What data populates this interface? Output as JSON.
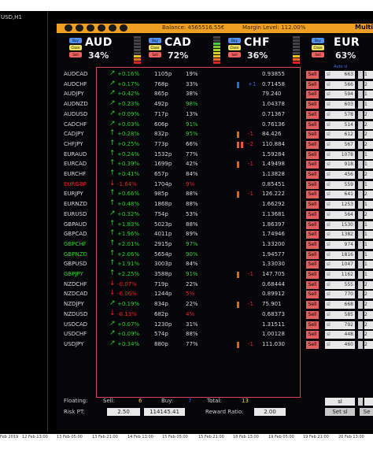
{
  "window": {
    "label": "USD,H1"
  },
  "topbar": {
    "balance": "Balance: 4565516.55€",
    "margin_level": "Margin Level: 112.00%",
    "multi": "Multi"
  },
  "currencies": [
    {
      "name": "AUD",
      "pct": "34%",
      "buy": "Buy",
      "close": "Close",
      "sell": "Sell"
    },
    {
      "name": "CAD",
      "pct": "72%",
      "buy": "Buy",
      "close": "Close",
      "sell": "Sell"
    },
    {
      "name": "CHF",
      "pct": "36%",
      "buy": "Buy",
      "close": "Close",
      "sell": "Sell"
    },
    {
      "name": "EUR",
      "pct": "63%",
      "buy": "Buy",
      "close": "Close",
      "sell": "Sell"
    }
  ],
  "auto_sl": "Auto sl",
  "rows": [
    {
      "pair": "AUDCAD",
      "pc": "white",
      "arrow": "↗",
      "ac": "green",
      "chg": "+0.16%",
      "cc": "green",
      "pips": "1105p",
      "perc": "19%",
      "pcc": "white",
      "mark": "",
      "mark2": "",
      "mlabel": "",
      "mlc": "white",
      "price": "0.93855",
      "sell": "Sell",
      "sl": "663",
      "last": "1"
    },
    {
      "pair": "AUDCHF",
      "pc": "white",
      "arrow": "↗",
      "ac": "green",
      "chg": "+0.17%",
      "cc": "green",
      "pips": "768p",
      "perc": "33%",
      "pcc": "white",
      "mark": "blue",
      "mark2": "",
      "mlabel": "+1",
      "mlc": "blue",
      "price": "0.71458",
      "sell": "Sell",
      "sl": "566",
      "last": "2"
    },
    {
      "pair": "AUDJPY",
      "pc": "white",
      "arrow": "↗",
      "ac": "green",
      "chg": "+0.42%",
      "cc": "green",
      "pips": "865p",
      "perc": "38%",
      "pcc": "white",
      "mark": "",
      "mark2": "",
      "mlabel": "",
      "mlc": "white",
      "price": "79.240",
      "sell": "Sell",
      "sl": "594",
      "last": "1"
    },
    {
      "pair": "AUDNZD",
      "pc": "white",
      "arrow": "↗",
      "ac": "green",
      "chg": "+0.23%",
      "cc": "green",
      "pips": "492p",
      "perc": "98%",
      "pcc": "green",
      "mark": "",
      "mark2": "",
      "mlabel": "",
      "mlc": "white",
      "price": "1.04378",
      "sell": "Sell",
      "sl": "603",
      "last": "1"
    },
    {
      "pair": "AUDUSD",
      "pc": "white",
      "arrow": "↗",
      "ac": "green",
      "chg": "+0.09%",
      "cc": "green",
      "pips": "717p",
      "perc": "13%",
      "pcc": "white",
      "mark": "",
      "mark2": "",
      "mlabel": "",
      "mlc": "white",
      "price": "0.71367",
      "sell": "Sell",
      "sl": "578",
      "last": "2"
    },
    {
      "pair": "CADCHF",
      "pc": "white",
      "arrow": "↗",
      "ac": "green",
      "chg": "+0.03%",
      "cc": "green",
      "pips": "606p",
      "perc": "91%",
      "pcc": "green",
      "mark": "",
      "mark2": "",
      "mlabel": "",
      "mlc": "white",
      "price": "0.76136",
      "sell": "Sell",
      "sl": "514",
      "last": "2"
    },
    {
      "pair": "CADJPY",
      "pc": "white",
      "arrow": "↑",
      "ac": "green",
      "chg": "+0.28%",
      "cc": "green",
      "pips": "832p",
      "perc": "95%",
      "pcc": "green",
      "mark": "orange",
      "mark2": "",
      "mlabel": "-1",
      "mlc": "red",
      "price": "84.426",
      "sell": "Sell",
      "sl": "612",
      "last": "2"
    },
    {
      "pair": "CHFJPY",
      "pc": "white",
      "arrow": "↑",
      "ac": "green",
      "chg": "+0.25%",
      "cc": "green",
      "pips": "773p",
      "perc": "66%",
      "pcc": "white",
      "mark": "orange",
      "mark2": "orange",
      "mlabel": "-2",
      "mlc": "red",
      "price": "110.884",
      "sell": "Sell",
      "sl": "567",
      "last": "2"
    },
    {
      "pair": "EURAUD",
      "pc": "white",
      "arrow": "↑",
      "ac": "green",
      "chg": "+0.24%",
      "cc": "green",
      "pips": "1532p",
      "perc": "77%",
      "pcc": "white",
      "mark": "",
      "mark2": "",
      "mlabel": "",
      "mlc": "white",
      "price": "1.59284",
      "sell": "Sell",
      "sl": "1078",
      "last": "1"
    },
    {
      "pair": "EURCAD",
      "pc": "white",
      "arrow": "↑",
      "ac": "green",
      "chg": "+0.39%",
      "cc": "green",
      "pips": "1699p",
      "perc": "42%",
      "pcc": "white",
      "mark": "orange",
      "mark2": "",
      "mlabel": "-1",
      "mlc": "red",
      "price": "1.49498",
      "sell": "Sell",
      "sl": "918",
      "last": "1"
    },
    {
      "pair": "EURCHF",
      "pc": "white",
      "arrow": "↑",
      "ac": "green",
      "chg": "+0.41%",
      "cc": "green",
      "pips": "657p",
      "perc": "84%",
      "pcc": "white",
      "mark": "",
      "mark2": "",
      "mlabel": "",
      "mlc": "white",
      "price": "1.13828",
      "sell": "Sell",
      "sl": "456",
      "last": "2"
    },
    {
      "pair": "EURGBP",
      "pc": "red",
      "arrow": "↓",
      "ac": "red",
      "chg": "-1.64%",
      "cc": "red",
      "pips": "1704p",
      "perc": "9%",
      "pcc": "red",
      "mark": "",
      "mark2": "",
      "mlabel": "",
      "mlc": "white",
      "price": "0.85451",
      "sell": "Sell",
      "sl": "559",
      "last": "1"
    },
    {
      "pair": "EURJPY",
      "pc": "white",
      "arrow": "↑",
      "ac": "green",
      "chg": "+0.66%",
      "cc": "green",
      "pips": "985p",
      "perc": "88%",
      "pcc": "white",
      "mark": "orange",
      "mark2": "",
      "mlabel": "-1",
      "mlc": "red",
      "price": "126.222",
      "sell": "Sell",
      "sl": "641",
      "last": "2"
    },
    {
      "pair": "EURNZD",
      "pc": "white",
      "arrow": "↑",
      "ac": "green",
      "chg": "+0.48%",
      "cc": "green",
      "pips": "1868p",
      "perc": "88%",
      "pcc": "white",
      "mark": "",
      "mark2": "",
      "mlabel": "",
      "mlc": "white",
      "price": "1.66292",
      "sell": "Sell",
      "sl": "1253",
      "last": "1"
    },
    {
      "pair": "EURUSD",
      "pc": "white",
      "arrow": "↗",
      "ac": "green",
      "chg": "+0.32%",
      "cc": "green",
      "pips": "754p",
      "perc": "53%",
      "pcc": "white",
      "mark": "",
      "mark2": "",
      "mlabel": "",
      "mlc": "white",
      "price": "1.13681",
      "sell": "Sell",
      "sl": "564",
      "last": "2"
    },
    {
      "pair": "GBPAUD",
      "pc": "white",
      "arrow": "↑",
      "ac": "green",
      "chg": "+1.83%",
      "cc": "green",
      "pips": "5023p",
      "perc": "88%",
      "pcc": "white",
      "mark": "",
      "mark2": "",
      "mlabel": "",
      "mlc": "white",
      "price": "1.86397",
      "sell": "Sell",
      "sl": "1530",
      "last": "1"
    },
    {
      "pair": "GBPCAD",
      "pc": "white",
      "arrow": "↑",
      "ac": "green",
      "chg": "+1.96%",
      "cc": "green",
      "pips": "4011p",
      "perc": "89%",
      "pcc": "white",
      "mark": "",
      "mark2": "",
      "mlabel": "",
      "mlc": "white",
      "price": "1.74946",
      "sell": "Sell",
      "sl": "1382",
      "last": "1"
    },
    {
      "pair": "GBPCHF",
      "pc": "green",
      "arrow": "↑",
      "ac": "green",
      "chg": "+2.01%",
      "cc": "green",
      "pips": "2915p",
      "perc": "97%",
      "pcc": "green",
      "mark": "",
      "mark2": "",
      "mlabel": "",
      "mlc": "white",
      "price": "1.33200",
      "sell": "Sell",
      "sl": "974",
      "last": "1"
    },
    {
      "pair": "GBPNZD",
      "pc": "green",
      "arrow": "↑",
      "ac": "green",
      "chg": "+2.06%",
      "cc": "green",
      "pips": "5654p",
      "perc": "90%",
      "pcc": "green",
      "mark": "",
      "mark2": "",
      "mlabel": "",
      "mlc": "white",
      "price": "1.94577",
      "sell": "Sell",
      "sl": "1816",
      "last": "1"
    },
    {
      "pair": "GBPUSD",
      "pc": "white",
      "arrow": "↑",
      "ac": "green",
      "chg": "+1.91%",
      "cc": "green",
      "pips": "3003p",
      "perc": "84%",
      "pcc": "white",
      "mark": "",
      "mark2": "",
      "mlabel": "",
      "mlc": "white",
      "price": "1.33030",
      "sell": "Sell",
      "sl": "1047",
      "last": "1"
    },
    {
      "pair": "GBPJPY",
      "pc": "green",
      "arrow": "↑",
      "ac": "green",
      "chg": "+2.25%",
      "cc": "green",
      "pips": "3588p",
      "perc": "91%",
      "pcc": "green",
      "mark": "orange",
      "mark2": "",
      "mlabel": "-1",
      "mlc": "red",
      "price": "147.705",
      "sell": "Sell",
      "sl": "1162",
      "last": "1"
    },
    {
      "pair": "NZDCHF",
      "pc": "white",
      "arrow": "↓",
      "ac": "red",
      "chg": "-0.07%",
      "cc": "red",
      "pips": "719p",
      "perc": "22%",
      "pcc": "white",
      "mark": "",
      "mark2": "",
      "mlabel": "",
      "mlc": "white",
      "price": "0.68444",
      "sell": "Sell",
      "sl": "555",
      "last": "2"
    },
    {
      "pair": "NZDCAD",
      "pc": "white",
      "arrow": "↓",
      "ac": "red",
      "chg": "-0.06%",
      "cc": "red",
      "pips": "1244p",
      "perc": "5%",
      "pcc": "red",
      "mark": "",
      "mark2": "",
      "mlabel": "",
      "mlc": "white",
      "price": "0.89912",
      "sell": "Sell",
      "sl": "770",
      "last": "2"
    },
    {
      "pair": "NZDJPY",
      "pc": "white",
      "arrow": "↗",
      "ac": "green",
      "chg": "+0.19%",
      "cc": "green",
      "pips": "834p",
      "perc": "22%",
      "pcc": "white",
      "mark": "orange",
      "mark2": "",
      "mlabel": "-1",
      "mlc": "red",
      "price": "75.901",
      "sell": "Sell",
      "sl": "668",
      "last": "2"
    },
    {
      "pair": "NZDUSD",
      "pc": "white",
      "arrow": "↓",
      "ac": "red",
      "chg": "-0.13%",
      "cc": "red",
      "pips": "682p",
      "perc": "4%",
      "pcc": "red",
      "mark": "",
      "mark2": "",
      "mlabel": "",
      "mlc": "white",
      "price": "0.68373",
      "sell": "Sell",
      "sl": "585",
      "last": "2"
    },
    {
      "pair": "USDCAD",
      "pc": "white",
      "arrow": "↗",
      "ac": "green",
      "chg": "+0.07%",
      "cc": "green",
      "pips": "1230p",
      "perc": "31%",
      "pcc": "white",
      "mark": "",
      "mark2": "",
      "mlabel": "",
      "mlc": "white",
      "price": "1.31511",
      "sell": "Sell",
      "sl": "792",
      "last": "2"
    },
    {
      "pair": "USDCHF",
      "pc": "white",
      "arrow": "↗",
      "ac": "green",
      "chg": "+0.09%",
      "cc": "green",
      "pips": "574p",
      "perc": "88%",
      "pcc": "white",
      "mark": "",
      "mark2": "",
      "mlabel": "",
      "mlc": "white",
      "price": "1.00128",
      "sell": "Sell",
      "sl": "448",
      "last": "2"
    },
    {
      "pair": "USDJPY",
      "pc": "white",
      "arrow": "↗",
      "ac": "green",
      "chg": "+0.34%",
      "cc": "green",
      "pips": "880p",
      "perc": "77%",
      "pcc": "white",
      "mark": "orange",
      "mark2": "",
      "mlabel": "-1",
      "mlc": "red",
      "price": "111.030",
      "sell": "Sell",
      "sl": "460",
      "last": "2"
    }
  ],
  "footer": {
    "floating": "Floating:",
    "sell_label": "Sell:",
    "sell_val": "6",
    "buy_label": "Buy:",
    "buy_val": "7",
    "total_label": "Total:",
    "total_val": "13",
    "risk_label": "Risk PT:",
    "risk_val": "2.50",
    "money_val": "114145.41",
    "reward_label": "Reward Ratio:",
    "reward_val": "2.00",
    "setsl": "Set sl",
    "set2": "Se"
  },
  "time_axis": [
    "Feb 2019",
    "12 Feb 13:00",
    "13 Feb 05:00",
    "13 Feb 21:00",
    "14 Feb 13:00",
    "15 Feb 05:00",
    "15 Feb 21:00",
    "18 Feb 13:00",
    "19 Feb 05:00",
    "19 Feb 21:00",
    "20 Feb 13:00"
  ]
}
